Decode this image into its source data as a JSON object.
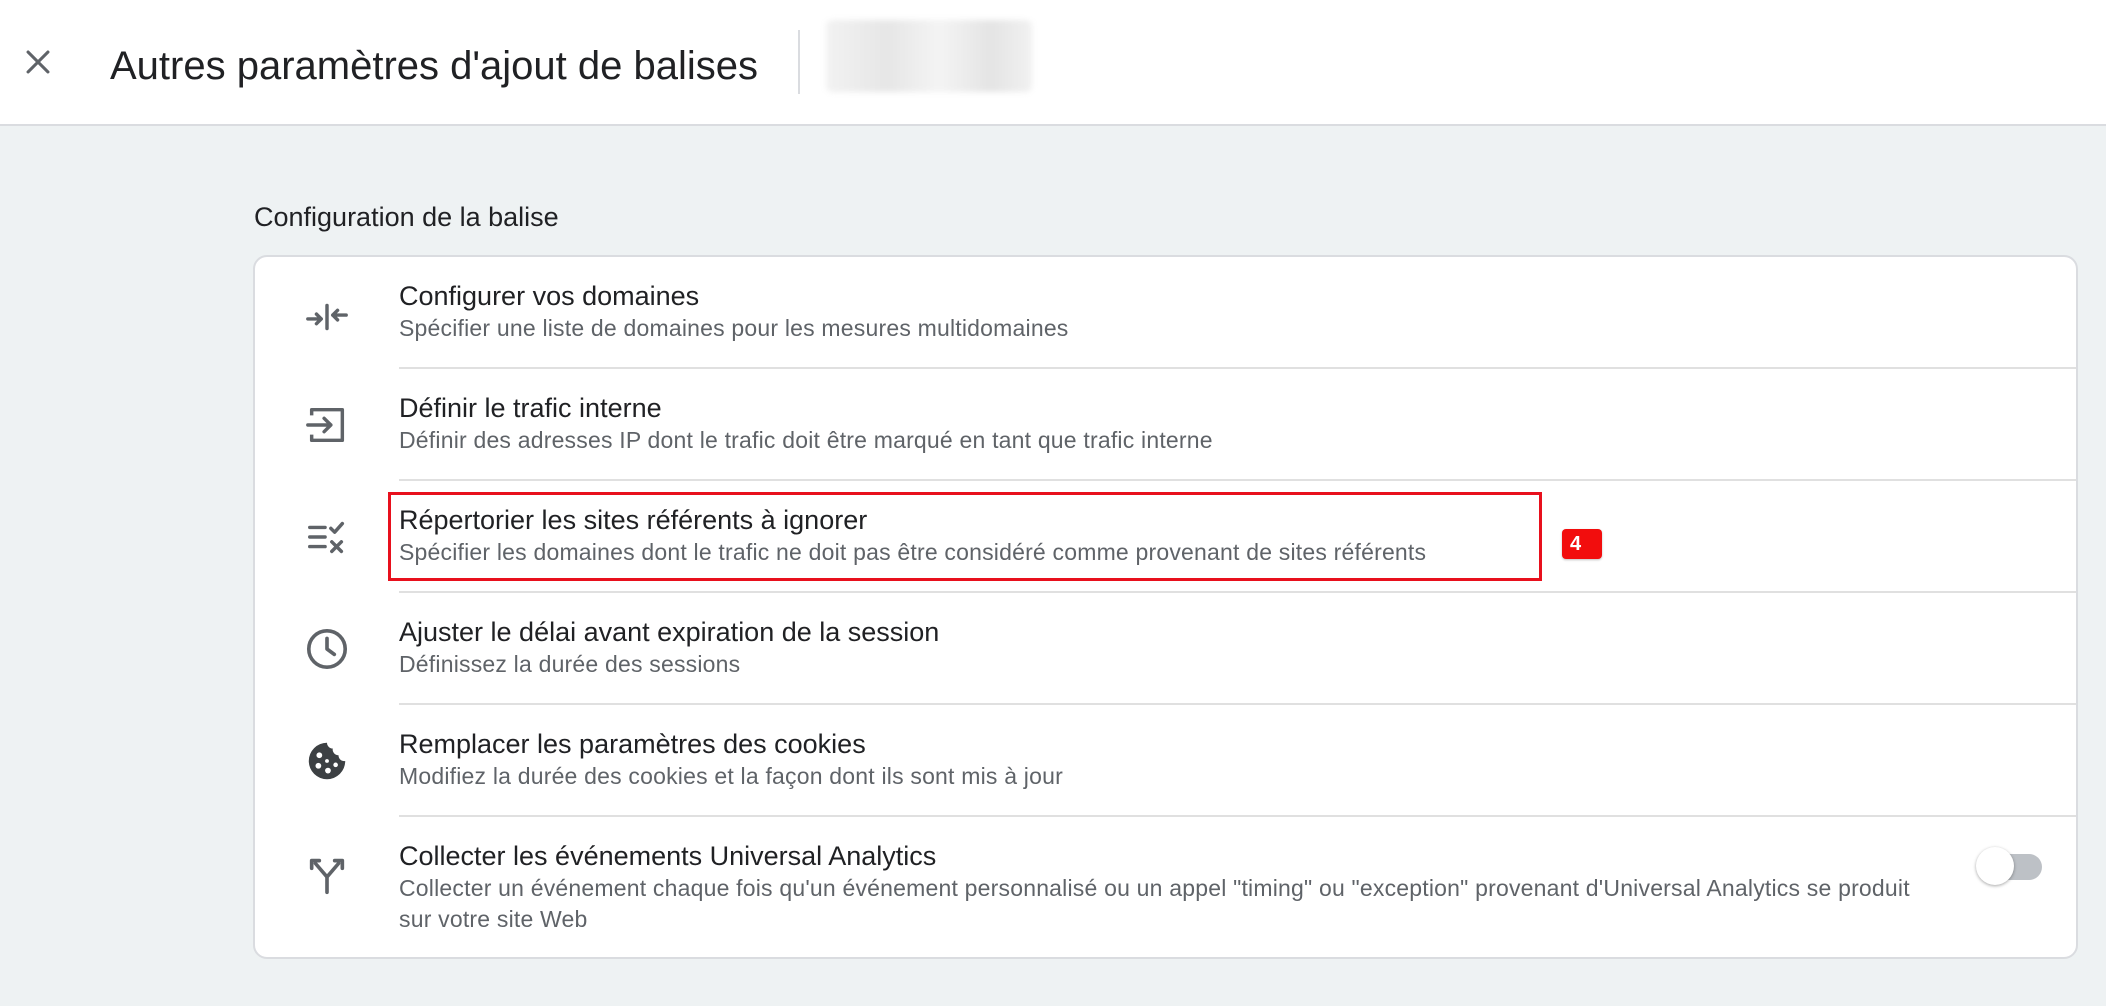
{
  "header": {
    "title": "Autres paramètres d'ajout de balises",
    "account_label": "",
    "close_icon": "close-icon"
  },
  "section": {
    "heading": "Configuration de la balise"
  },
  "items": [
    {
      "icon": "arrows-merge-icon",
      "title": "Configurer vos domaines",
      "description": "Spécifier une liste de domaines pour les mesures multidomaines"
    },
    {
      "icon": "input-arrow-icon",
      "title": "Définir le trafic interne",
      "description": "Définir des adresses IP dont le trafic doit être marqué en tant que trafic interne"
    },
    {
      "icon": "list-check-cross-icon",
      "title": "Répertorier les sites référents à ignorer",
      "description": "Spécifier les domaines dont le trafic ne doit pas être considéré comme provenant de sites référents"
    },
    {
      "icon": "clock-icon",
      "title": "Ajuster le délai avant expiration de la session",
      "description": "Définissez la durée des sessions"
    },
    {
      "icon": "cookie-icon",
      "title": "Remplacer les paramètres des cookies",
      "description": "Modifiez la durée des cookies et la façon dont ils sont mis à jour"
    },
    {
      "icon": "fork-arrows-icon",
      "title": "Collecter les événements Universal Analytics",
      "description": "Collecter un événement chaque fois qu'un événement personnalisé ou un appel \"timing\" ou \"exception\" provenant d'Universal Analytics se produit sur votre site Web",
      "toggle_on": false
    }
  ],
  "annotation": {
    "badge": "4",
    "color": "#e8101d"
  },
  "colors": {
    "background": "#eef2f3",
    "card": "#ffffff",
    "icon": "#5f6368"
  }
}
